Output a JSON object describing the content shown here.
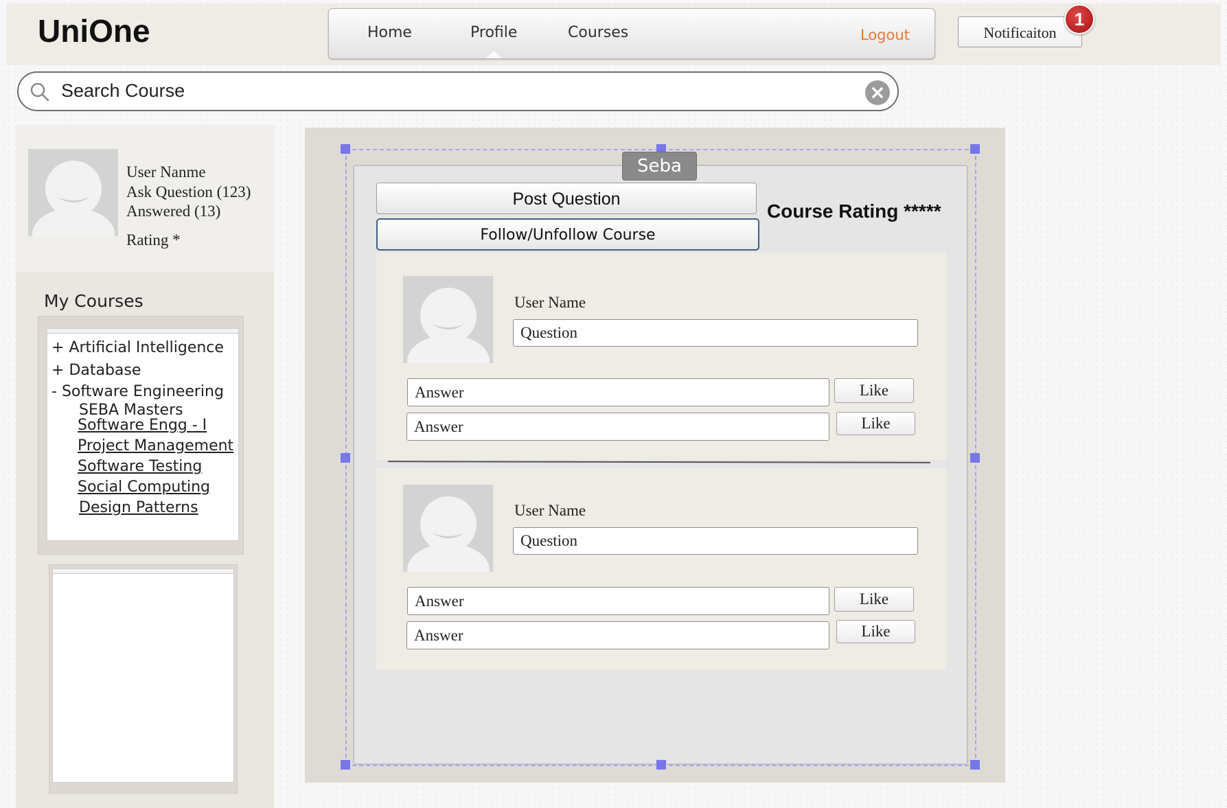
{
  "header": {
    "brand": "UniOne",
    "nav": {
      "home": "Home",
      "profile": "Profile",
      "courses": "Courses",
      "logout": "Logout"
    },
    "notification": {
      "label": "Notificaiton",
      "count": "1"
    }
  },
  "search": {
    "value": "Search Course"
  },
  "profile": {
    "user_name": "User Nanme",
    "ask_question": "Ask Question (123)",
    "answered": "Answered (13)",
    "rating": "Rating *"
  },
  "my_courses": {
    "title": "My Courses",
    "items": [
      {
        "prefix": "+",
        "label": "Artificial Intelligence"
      },
      {
        "prefix": "+",
        "label": "Database"
      },
      {
        "prefix": "-",
        "label": "Software Engineering"
      }
    ],
    "sub_header": "SEBA Masters",
    "sub_items": [
      "Software Engg - I",
      "Project Management",
      "Software Testing",
      "Social Computing",
      "Design Patterns"
    ]
  },
  "main": {
    "tab": "Seba",
    "post_question": "Post Question",
    "follow_course": "Follow/Unfollow  Course",
    "course_rating": "Course Rating *****",
    "posts": [
      {
        "user": "User Name",
        "question": "Question",
        "answers": [
          "Answer",
          "Answer"
        ],
        "like": "Like"
      },
      {
        "user": "User Name",
        "question": "Question",
        "answers": [
          "Answer",
          "Answer"
        ],
        "like": "Like"
      }
    ]
  },
  "colors": {
    "logout": "#e27a3c",
    "badge": "#c81e1e",
    "selection": "#7777e8"
  }
}
